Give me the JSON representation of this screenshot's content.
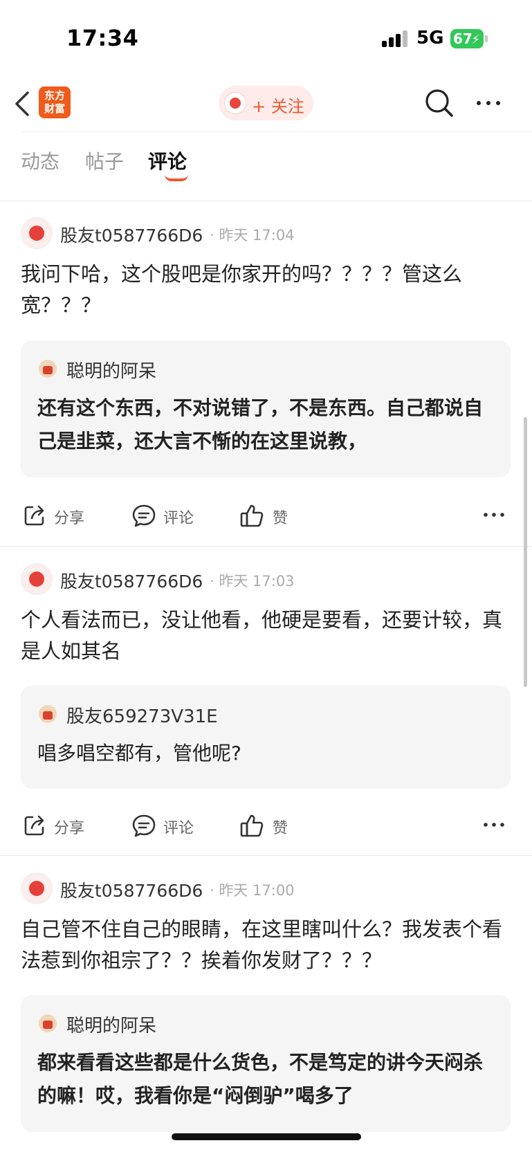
{
  "status_bar": {
    "time": "17:34",
    "network": "5G",
    "battery": "67"
  },
  "nav": {
    "logo_line1": "东方",
    "logo_line2": "财富",
    "follow_label": "+ 关注"
  },
  "tabs": [
    {
      "label": "动态",
      "active": false
    },
    {
      "label": "帖子",
      "active": false
    },
    {
      "label": "评论",
      "active": true
    }
  ],
  "actions": {
    "share": "分享",
    "comment": "评论",
    "like": "赞"
  },
  "posts": [
    {
      "author": "股友t0587766D6",
      "time": "· 昨天 17:04",
      "body": "我问下哈，这个股吧是你家开的吗？？？？管这么宽？？？",
      "quote_author": "聪明的阿呆",
      "quote_text": "还有这个东西，不对说错了，不是东西。自己都说自己是韭菜，还大言不惭的在这里说教，"
    },
    {
      "author": "股友t0587766D6",
      "time": "· 昨天 17:03",
      "body": "个人看法而已，没让他看，他硬是要看，还要计较，真是人如其名",
      "quote_author": "股友659273V31E",
      "quote_text": "唱多唱空都有，管他呢?"
    },
    {
      "author": "股友t0587766D6",
      "time": "· 昨天 17:00",
      "body": "自己管不住自己的眼睛，在这里瞎叫什么？我发表个看法惹到你祖宗了？？挨着你发财了？？？",
      "quote_author": "聪明的阿呆",
      "quote_text": "都来看看这些都是什么货色，不是笃定的讲今天闷杀的嘛！哎，我看你是“闷倒驴”喝多了"
    }
  ]
}
